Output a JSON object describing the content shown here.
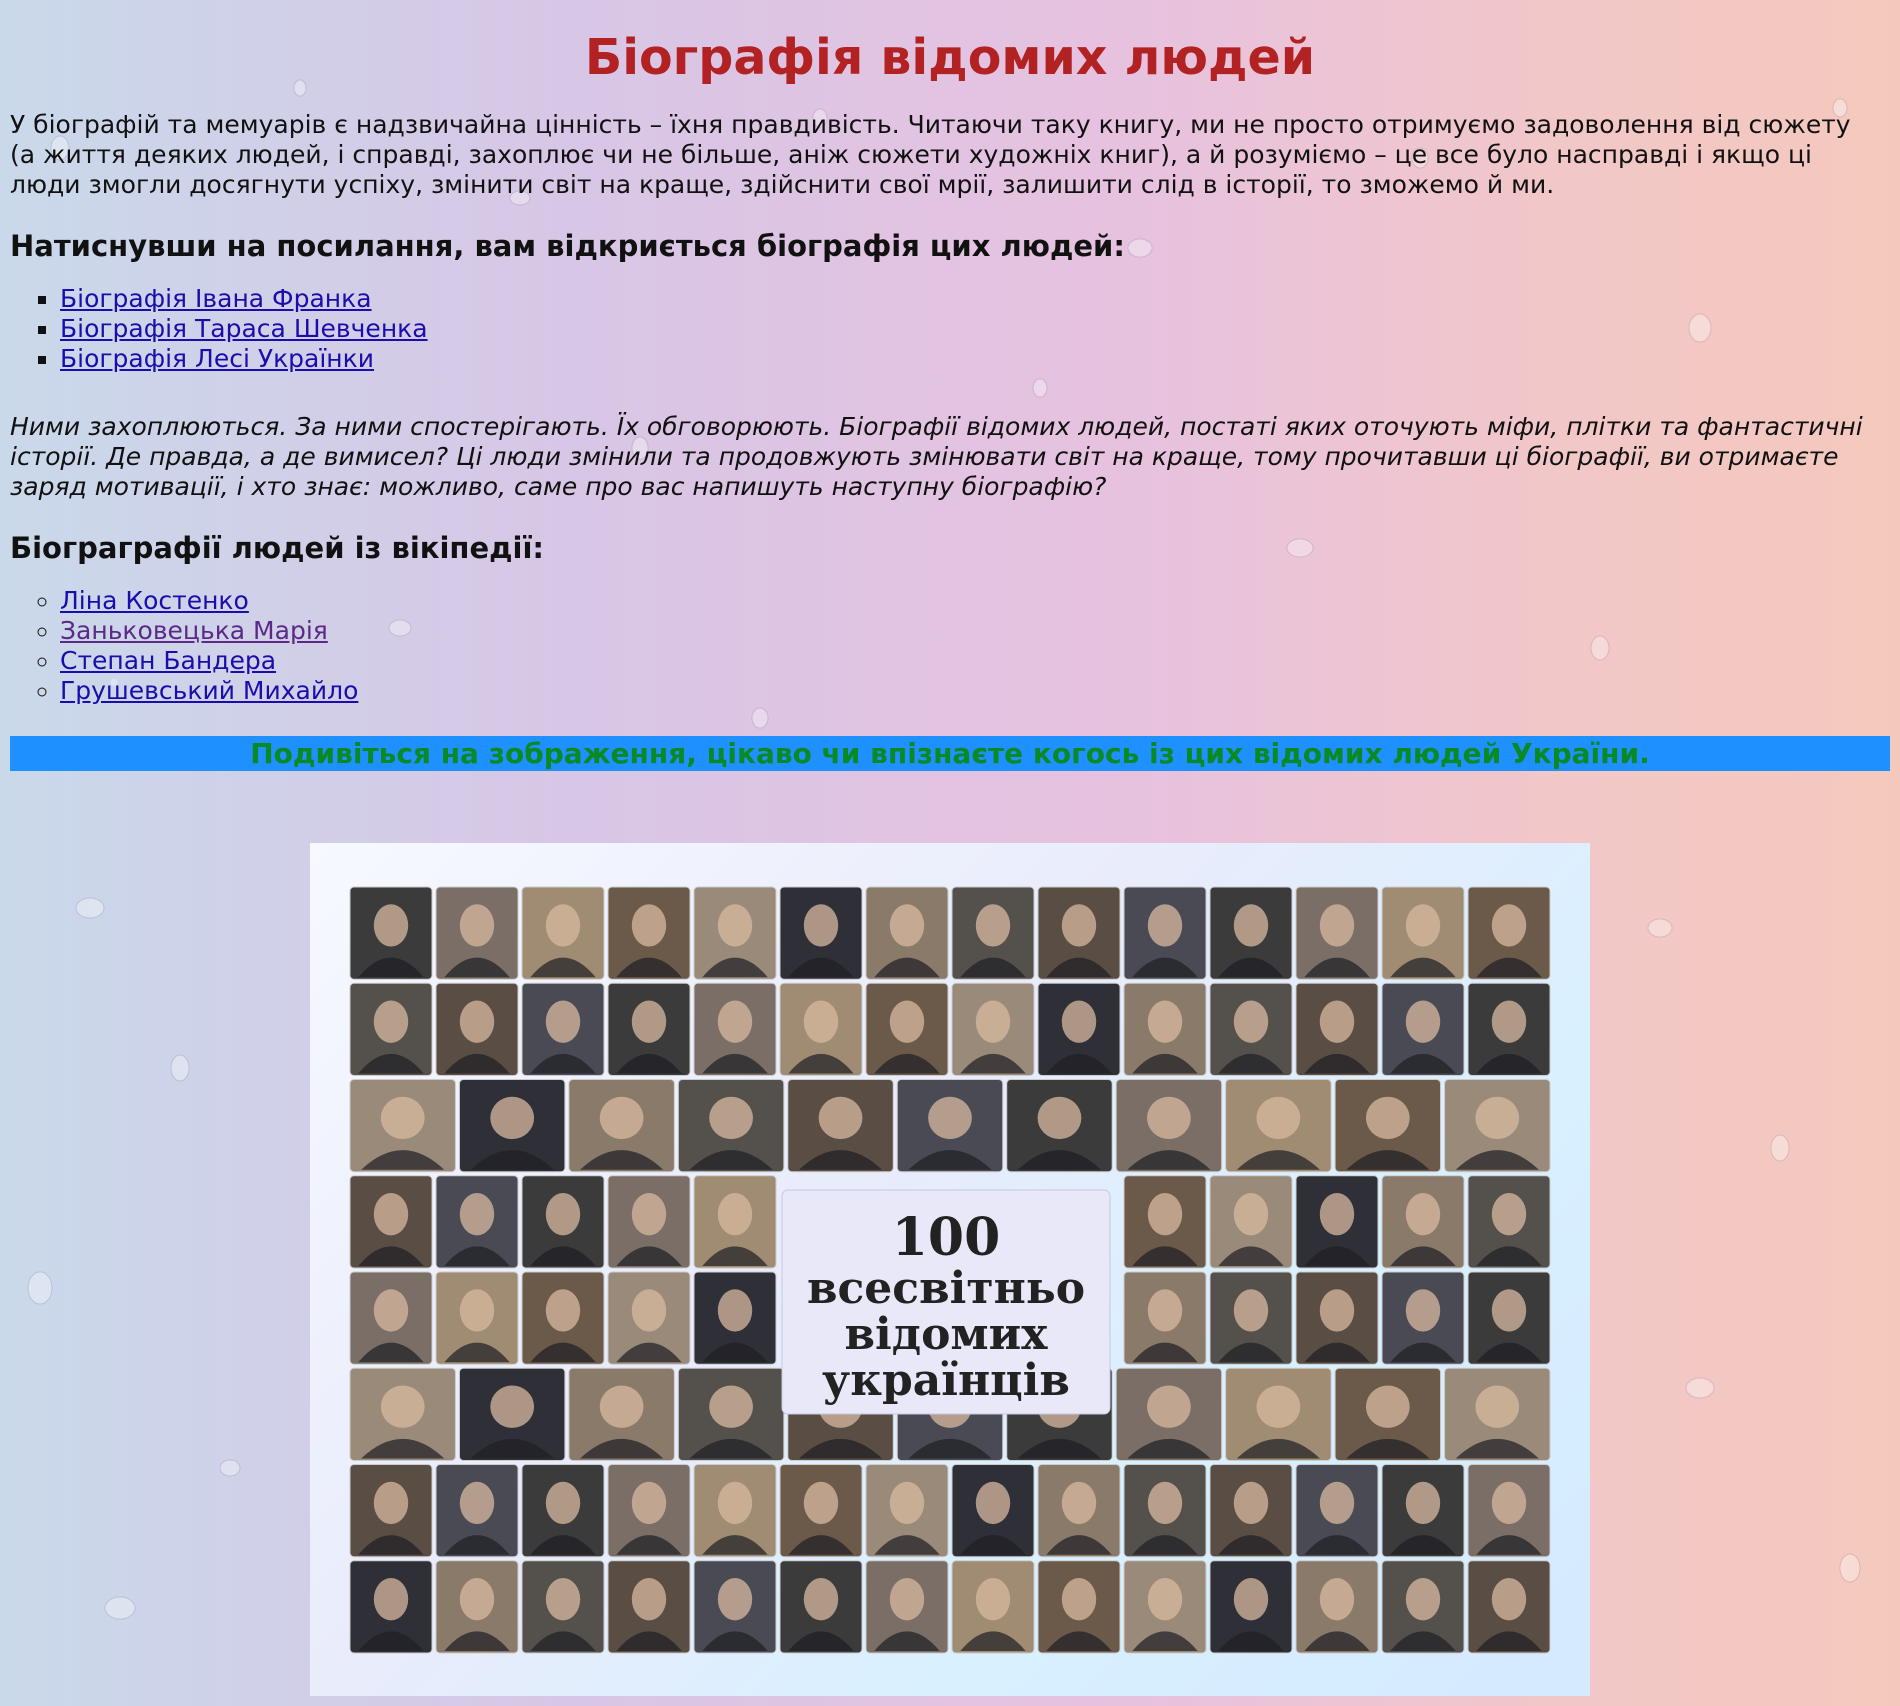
{
  "title": "Біографія відомих людей",
  "intro": "У біографій та мемуарів є надзвичайна цінність – їхня правдивість. Читаючи таку книгу, ми не просто отримуємо задоволення від сюжету (а життя деяких людей, і справді, захоплює чи не більше, аніж сюжети художніх книг), а й розуміємо – це все було насправді і якщо ці люди змогли досягнути успіху, змінити світ на краще, здійснити свої мрії, залишити слід в історії, то зможемо й ми.",
  "section1": {
    "heading": "Натиснувши на посилання, вам відкриється біографія цих людей:",
    "links": [
      "Біографія Івана Франка",
      "Біографія Тараса Шевченка",
      "Біографія Лесі Українки"
    ]
  },
  "quote": "Ними захоплюються. За ними спостерігають. Їх обговорюють. Біографії відомих людей, постаті яких оточують міфи, плітки та фантастичні історії. Де правда, а де вимисел? Ці люди змінили та продовжують змінювати світ на краще, тому прочитавши ці біографії, ви отримаєте заряд мотивації, і хто знає: можливо, саме про вас напишуть наступну біографію?",
  "section2": {
    "heading": "Біограграфії людей із вікіпедії:",
    "links": [
      "Ліна Костенко",
      "Заньковецька Марія",
      "Степан Бандера",
      "Грушевський Михайло"
    ]
  },
  "banner": "Подивіться на зображення, цікаво чи впізнаєте когось із цих відомих людей України.",
  "collage": {
    "center_lines": [
      "100",
      "всесвітньо",
      "відомих",
      "українців"
    ]
  },
  "colors": {
    "title": "#b22222",
    "link": "#1a0dab",
    "visited_link": "#5b2a86",
    "banner_bg": "#1e90ff",
    "banner_text": "#0a8a22"
  }
}
